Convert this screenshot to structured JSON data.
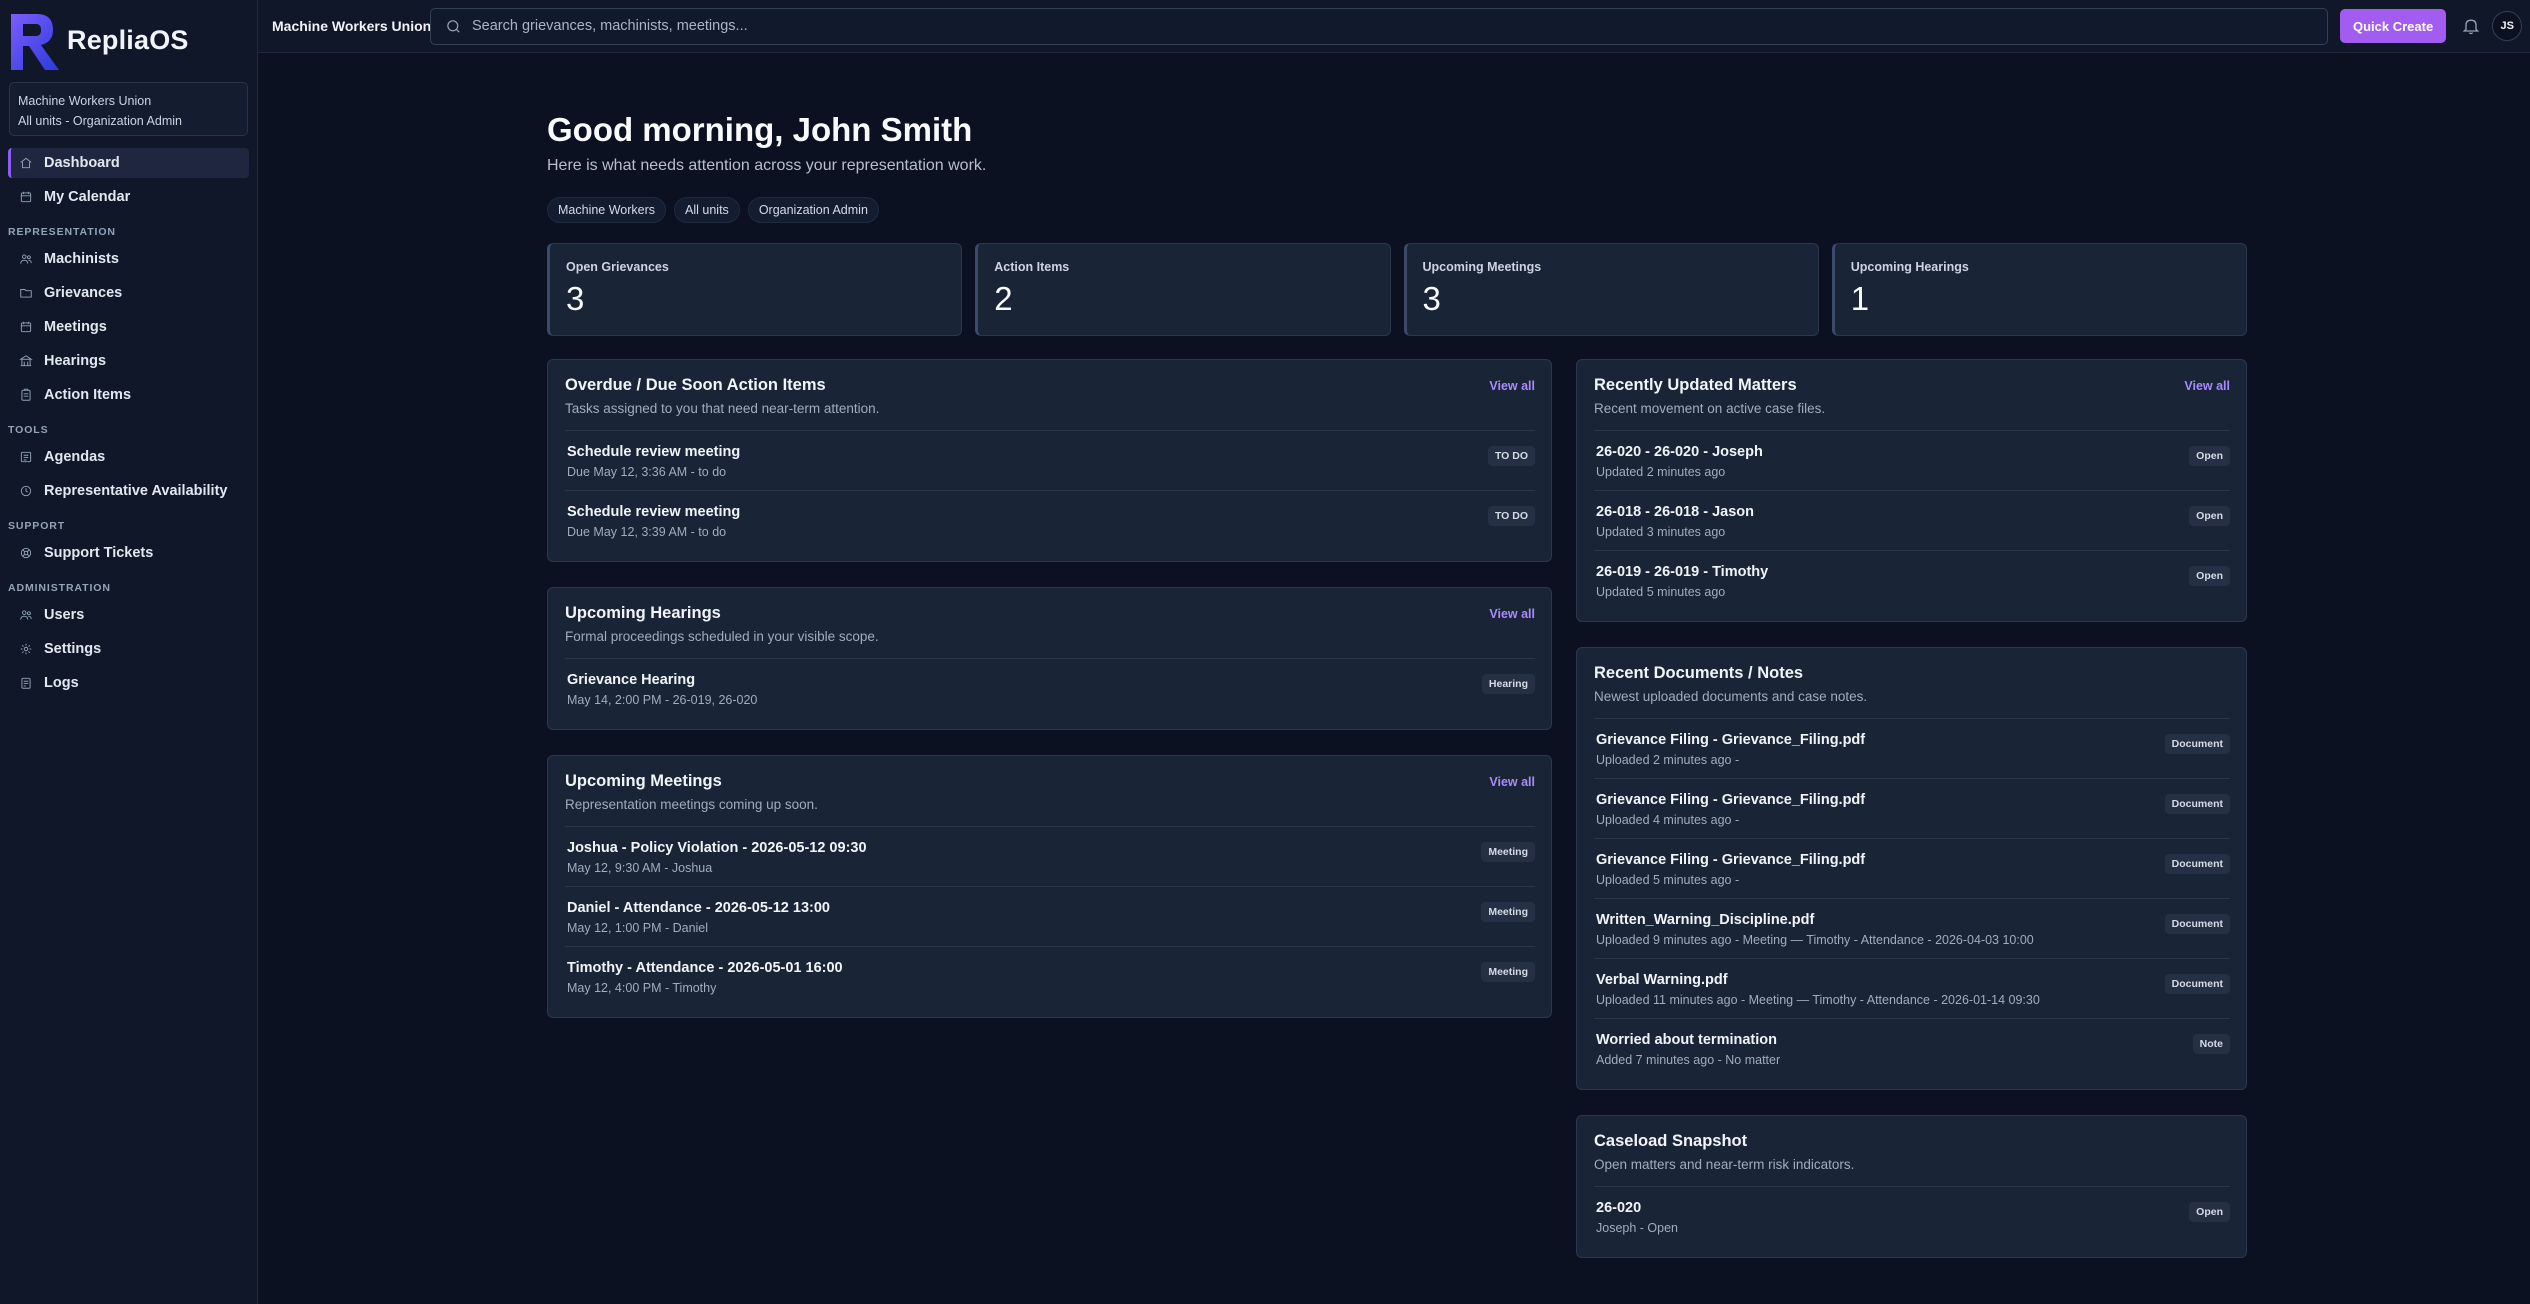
{
  "app": {
    "name": "RepliaOS"
  },
  "org_box": {
    "line1": "Machine Workers Union",
    "line2": "All units - Organization Admin"
  },
  "sidebar": {
    "top": [
      {
        "label": "Dashboard",
        "icon": "home-icon",
        "active": true
      },
      {
        "label": "My Calendar",
        "icon": "calendar-icon"
      }
    ],
    "sections": [
      {
        "title": "REPRESENTATION",
        "items": [
          {
            "label": "Machinists",
            "icon": "users-icon"
          },
          {
            "label": "Grievances",
            "icon": "folder-icon"
          },
          {
            "label": "Meetings",
            "icon": "calendar-icon"
          },
          {
            "label": "Hearings",
            "icon": "building-icon"
          },
          {
            "label": "Action Items",
            "icon": "clipboard-icon"
          }
        ]
      },
      {
        "title": "TOOLS",
        "items": [
          {
            "label": "Agendas",
            "icon": "list-icon"
          },
          {
            "label": "Representative Availability",
            "icon": "clock-icon"
          }
        ]
      },
      {
        "title": "SUPPORT",
        "items": [
          {
            "label": "Support Tickets",
            "icon": "ticket-icon"
          }
        ]
      },
      {
        "title": "ADMINISTRATION",
        "items": [
          {
            "label": "Users",
            "icon": "users-icon"
          },
          {
            "label": "Settings",
            "icon": "gear-icon"
          },
          {
            "label": "Logs",
            "icon": "log-icon"
          }
        ]
      }
    ]
  },
  "topbar": {
    "org": "Machine Workers Union",
    "search_placeholder": "Search grievances, machinists, meetings...",
    "quick_create": "Quick Create",
    "avatar": "JS"
  },
  "greeting": {
    "title": "Good morning, John Smith",
    "subtitle": "Here is what needs attention across your representation work.",
    "chips": [
      "Machine Workers",
      "All units",
      "Organization Admin"
    ]
  },
  "stats": [
    {
      "label": "Open Grievances",
      "value": "3"
    },
    {
      "label": "Action Items",
      "value": "2"
    },
    {
      "label": "Upcoming Meetings",
      "value": "3"
    },
    {
      "label": "Upcoming Hearings",
      "value": "1"
    }
  ],
  "cards_left": [
    {
      "title": "Overdue / Due Soon Action Items",
      "subtitle": "Tasks assigned to you that need near-term attention.",
      "view_all": "View all",
      "rows": [
        {
          "title": "Schedule review meeting",
          "meta": "Due May 12, 3:36 AM - to do",
          "badge": "TO DO"
        },
        {
          "title": "Schedule review meeting",
          "meta": "Due May 12, 3:39 AM - to do",
          "badge": "TO DO"
        }
      ]
    },
    {
      "title": "Upcoming Hearings",
      "subtitle": "Formal proceedings scheduled in your visible scope.",
      "view_all": "View all",
      "rows": [
        {
          "title": "Grievance Hearing",
          "meta": "May 14, 2:00 PM - 26-019, 26-020",
          "badge": "Hearing"
        }
      ]
    },
    {
      "title": "Upcoming Meetings",
      "subtitle": "Representation meetings coming up soon.",
      "view_all": "View all",
      "rows": [
        {
          "title": "Joshua - Policy Violation - 2026-05-12 09:30",
          "meta": "May 12, 9:30 AM - Joshua",
          "badge": "Meeting"
        },
        {
          "title": "Daniel - Attendance - 2026-05-12 13:00",
          "meta": "May 12, 1:00 PM - Daniel",
          "badge": "Meeting"
        },
        {
          "title": "Timothy - Attendance - 2026-05-01 16:00",
          "meta": "May 12, 4:00 PM - Timothy",
          "badge": "Meeting"
        }
      ]
    }
  ],
  "cards_right": [
    {
      "title": "Recently Updated Matters",
      "subtitle": "Recent movement on active case files.",
      "view_all": "View all",
      "rows": [
        {
          "title": "26-020 - 26-020 - Joseph",
          "meta": "Updated 2 minutes ago",
          "badge": "Open"
        },
        {
          "title": "26-018 - 26-018 - Jason",
          "meta": "Updated 3 minutes ago",
          "badge": "Open"
        },
        {
          "title": "26-019 - 26-019 - Timothy",
          "meta": "Updated 5 minutes ago",
          "badge": "Open"
        }
      ]
    },
    {
      "title": "Recent Documents / Notes",
      "subtitle": "Newest uploaded documents and case notes.",
      "view_all": "",
      "rows": [
        {
          "title": "Grievance Filing - Grievance_Filing.pdf",
          "meta": "Uploaded 2 minutes ago -",
          "badge": "Document"
        },
        {
          "title": "Grievance Filing - Grievance_Filing.pdf",
          "meta": "Uploaded 4 minutes ago -",
          "badge": "Document"
        },
        {
          "title": "Grievance Filing - Grievance_Filing.pdf",
          "meta": "Uploaded 5 minutes ago -",
          "badge": "Document"
        },
        {
          "title": "Written_Warning_Discipline.pdf",
          "meta": "Uploaded 9 minutes ago - Meeting — Timothy - Attendance - 2026-04-03 10:00",
          "badge": "Document"
        },
        {
          "title": "Verbal Warning.pdf",
          "meta": "Uploaded 11 minutes ago - Meeting — Timothy - Attendance - 2026-01-14 09:30",
          "badge": "Document"
        },
        {
          "title": "Worried about termination",
          "meta": "Added 7 minutes ago - No matter",
          "badge": "Note"
        }
      ]
    },
    {
      "title": "Caseload Snapshot",
      "subtitle": "Open matters and near-term risk indicators.",
      "view_all": "",
      "rows": [
        {
          "title": "26-020",
          "meta": "Joseph - Open",
          "badge": "Open"
        }
      ]
    }
  ]
}
